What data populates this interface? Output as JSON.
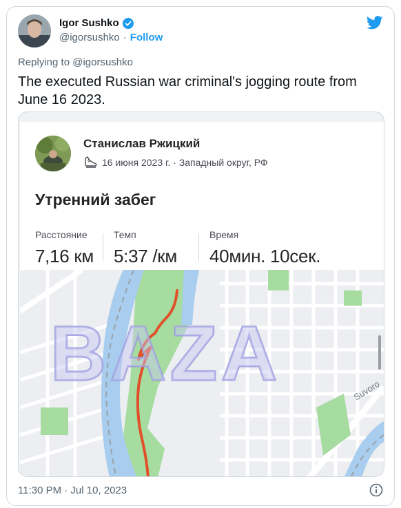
{
  "tweet": {
    "author_name": "Igor Sushko",
    "author_handle": "@igorsushko",
    "separator": "·",
    "follow_label": "Follow",
    "replying_to": "Replying to @igorsushko",
    "text": "The executed Russian war criminal's jogging route from June 16 2023.",
    "timestamp": "11:30 PM · Jul 10, 2023",
    "icons": [
      "verified-badge-icon",
      "twitter-bird-icon",
      "info-icon"
    ],
    "colors": {
      "accent": "#1d9bf0",
      "secondary_text": "#536471",
      "border": "#cfd9de"
    }
  },
  "activity": {
    "runner_name": "Станислав Ржицкий",
    "meta": "16 июня 2023 г. · Западный округ, РФ",
    "title": "Утренний забег",
    "stats": [
      {
        "label": "Расстояние",
        "value": "7,16 км"
      },
      {
        "label": "Темп",
        "value": "5:37 /км"
      },
      {
        "label": "Время",
        "value": "40мин. 10сек."
      }
    ],
    "icons": [
      "running-shoe-icon"
    ]
  },
  "map": {
    "watermark": "BAZA",
    "street_label": "Suvoro",
    "colors": {
      "route": "#e0502a",
      "river": "#a8cdee",
      "park": "#a6dca0",
      "watermark": "#b4b4e6"
    }
  }
}
